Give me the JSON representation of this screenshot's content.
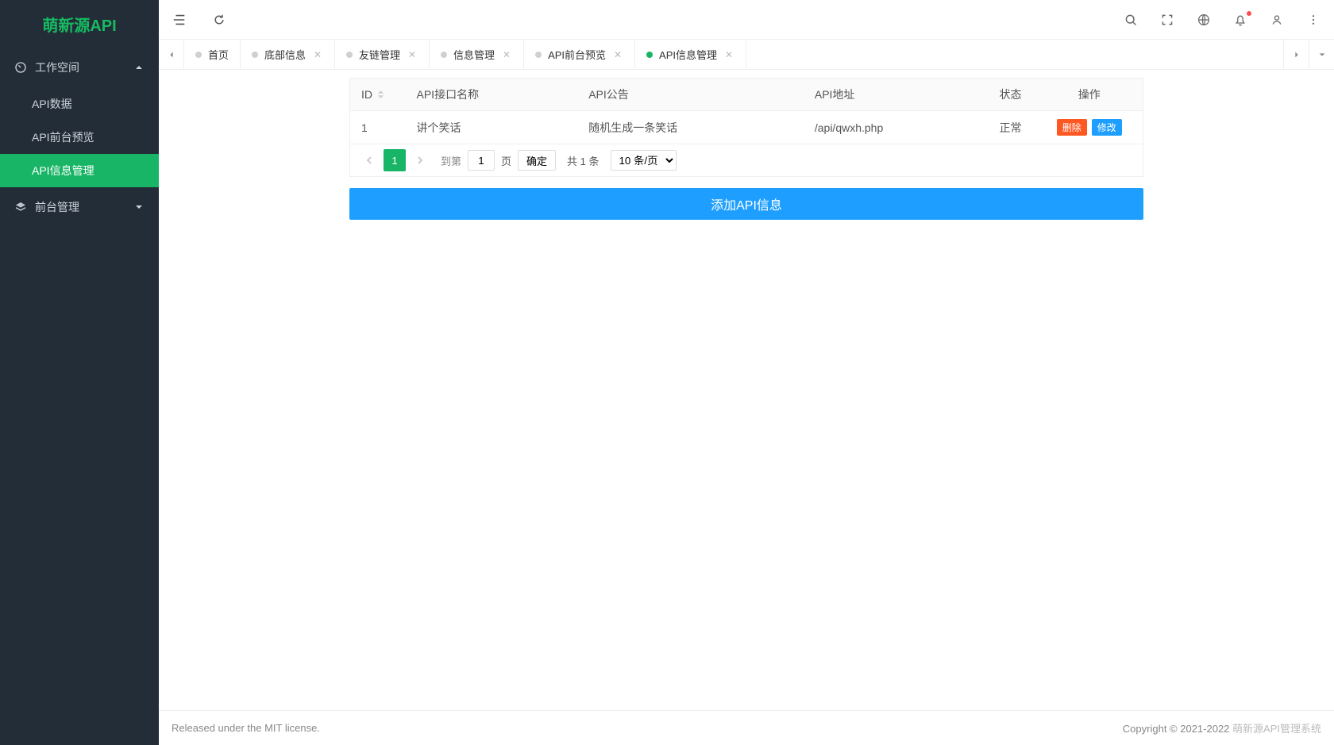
{
  "logo": "萌新源API",
  "sidebar": {
    "workspace": {
      "label": "工作空间"
    },
    "items": [
      {
        "label": "API数据"
      },
      {
        "label": "API前台预览"
      },
      {
        "label": "API信息管理"
      }
    ],
    "frontend": {
      "label": "前台管理"
    }
  },
  "tabs": [
    {
      "label": "首页",
      "closable": false,
      "active": false
    },
    {
      "label": "底部信息",
      "closable": true,
      "active": false
    },
    {
      "label": "友链管理",
      "closable": true,
      "active": false
    },
    {
      "label": "信息管理",
      "closable": true,
      "active": false
    },
    {
      "label": "API前台预览",
      "closable": true,
      "active": false
    },
    {
      "label": "API信息管理",
      "closable": true,
      "active": true
    }
  ],
  "table": {
    "headers": {
      "id": "ID",
      "name": "API接口名称",
      "notice": "API公告",
      "addr": "API地址",
      "state": "状态",
      "op": "操作"
    },
    "rows": [
      {
        "id": "1",
        "name": "讲个笑话",
        "notice": "随机生成一条笑话",
        "addr": "/api/qwxh.php",
        "state": "正常"
      }
    ],
    "actions": {
      "del": "删除",
      "edit": "修改"
    }
  },
  "pagination": {
    "current": "1",
    "goto_prefix": "到第",
    "goto_value": "1",
    "goto_suffix": "页",
    "confirm": "确定",
    "total": "共 1 条",
    "page_size": "10 条/页"
  },
  "add_button": "添加API信息",
  "footer": {
    "left": "Released under the MIT license.",
    "right_prefix": "Copyright © 2021-2022 ",
    "right_suffix": "萌新源API管理系统"
  }
}
